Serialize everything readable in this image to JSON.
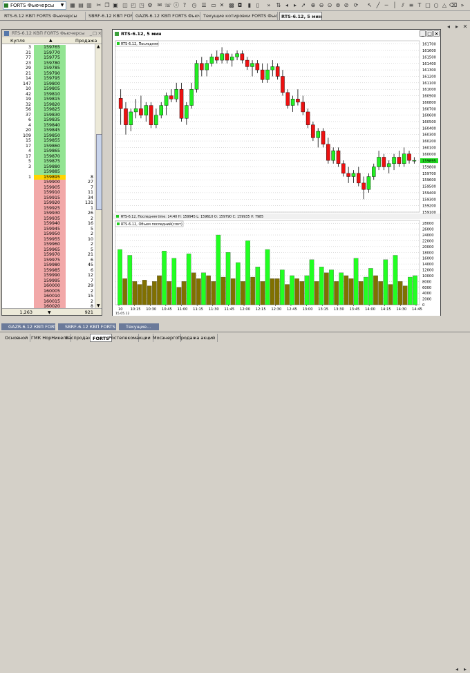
{
  "toolbar": {
    "instrument_select": "FORTS Фьючерсы"
  },
  "tabs": [
    {
      "label": "RTS-6.12 КВП FORTS Фьючерсы",
      "active": false
    },
    {
      "label": "SBRF-6.12 КВП FORTS Фьючерсы",
      "active": false
    },
    {
      "label": "GAZR-6.12 КВП FORTS Фьючерсы",
      "active": false
    },
    {
      "label": "Текущие котировки FORTS Фьючерсы",
      "active": false
    },
    {
      "label": "RTS-6.12, 5 мин",
      "active": true
    }
  ],
  "depth": {
    "title": "RTS-6.12 КВП FORTS Фьючерсы",
    "col_buy": "Купля",
    "col_sell": "Продажа",
    "footer_buy": "1,263",
    "footer_sell": "921",
    "rows": [
      {
        "buy": "3",
        "price": "159765",
        "sell": ""
      },
      {
        "buy": "31",
        "price": "159770",
        "sell": ""
      },
      {
        "buy": "77",
        "price": "159775",
        "sell": ""
      },
      {
        "buy": "23",
        "price": "159780",
        "sell": ""
      },
      {
        "buy": "29",
        "price": "159785",
        "sell": ""
      },
      {
        "buy": "21",
        "price": "159790",
        "sell": ""
      },
      {
        "buy": "14",
        "price": "159795",
        "sell": ""
      },
      {
        "buy": "147",
        "price": "159800",
        "sell": ""
      },
      {
        "buy": "10",
        "price": "159805",
        "sell": ""
      },
      {
        "buy": "42",
        "price": "159810",
        "sell": ""
      },
      {
        "buy": "19",
        "price": "159815",
        "sell": ""
      },
      {
        "buy": "32",
        "price": "159820",
        "sell": ""
      },
      {
        "buy": "56",
        "price": "159825",
        "sell": ""
      },
      {
        "buy": "37",
        "price": "159830",
        "sell": ""
      },
      {
        "buy": "6",
        "price": "159835",
        "sell": ""
      },
      {
        "buy": "4",
        "price": "159840",
        "sell": ""
      },
      {
        "buy": "20",
        "price": "159845",
        "sell": ""
      },
      {
        "buy": "109",
        "price": "159850",
        "sell": ""
      },
      {
        "buy": "15",
        "price": "159855",
        "sell": ""
      },
      {
        "buy": "17",
        "price": "159860",
        "sell": ""
      },
      {
        "buy": "4",
        "price": "159865",
        "sell": ""
      },
      {
        "buy": "17",
        "price": "159870",
        "sell": ""
      },
      {
        "buy": "5",
        "price": "159875",
        "sell": ""
      },
      {
        "buy": "3",
        "price": "159880",
        "sell": ""
      },
      {
        "buy": "",
        "price": "159885",
        "sell": ""
      },
      {
        "buy": "1",
        "price": "159895",
        "sell": "8",
        "current": true
      },
      {
        "buy": "",
        "price": "159900",
        "sell": "27"
      },
      {
        "buy": "",
        "price": "159905",
        "sell": "7"
      },
      {
        "buy": "",
        "price": "159910",
        "sell": "11"
      },
      {
        "buy": "",
        "price": "159915",
        "sell": "34"
      },
      {
        "buy": "",
        "price": "159920",
        "sell": "131"
      },
      {
        "buy": "",
        "price": "159925",
        "sell": "1"
      },
      {
        "buy": "",
        "price": "159930",
        "sell": "26"
      },
      {
        "buy": "",
        "price": "159935",
        "sell": "2"
      },
      {
        "buy": "",
        "price": "159940",
        "sell": "16"
      },
      {
        "buy": "",
        "price": "159945",
        "sell": "5"
      },
      {
        "buy": "",
        "price": "159950",
        "sell": "2"
      },
      {
        "buy": "",
        "price": "159955",
        "sell": "10"
      },
      {
        "buy": "",
        "price": "159960",
        "sell": "2"
      },
      {
        "buy": "",
        "price": "159965",
        "sell": "5"
      },
      {
        "buy": "",
        "price": "159970",
        "sell": "21"
      },
      {
        "buy": "",
        "price": "159975",
        "sell": "6"
      },
      {
        "buy": "",
        "price": "159980",
        "sell": "45"
      },
      {
        "buy": "",
        "price": "159985",
        "sell": "6"
      },
      {
        "buy": "",
        "price": "159990",
        "sell": "12"
      },
      {
        "buy": "",
        "price": "159995",
        "sell": "7"
      },
      {
        "buy": "",
        "price": "160000",
        "sell": "29"
      },
      {
        "buy": "",
        "price": "160005",
        "sell": "2"
      },
      {
        "buy": "",
        "price": "160010",
        "sell": "15"
      },
      {
        "buy": "",
        "price": "160015",
        "sell": "2"
      },
      {
        "buy": "",
        "price": "160020",
        "sell": "8"
      }
    ]
  },
  "chart": {
    "window_title": "RTS-6.12, 5 мин",
    "price_legend": "RTS-6.12, Последняя",
    "volume_info": "RTS-6.12, Последняя time: 14:40 H: 159945 L: 159610 O: 159790 C: 159935 V: 7985",
    "volume_legend": "RTS-6.12, Объем последний(слот)",
    "current_price_label": "159895",
    "colors": {
      "up": "#22ee22",
      "down": "#ee1111",
      "vol_up": "#22ff22",
      "vol_down": "#807000"
    }
  },
  "chart_data": [
    {
      "type": "candlestick",
      "y_ticks": [
        "161700",
        "161600",
        "161500",
        "161400",
        "161300",
        "161200",
        "161100",
        "161000",
        "160900",
        "160800",
        "160700",
        "160600",
        "160500",
        "160400",
        "160300",
        "160200",
        "160100",
        "160000",
        "159900",
        "159800",
        "159700",
        "159600",
        "159500",
        "159400",
        "159300",
        "159200",
        "159100"
      ],
      "ylim": [
        159100,
        161750
      ],
      "candles": [
        {
          "o": 160860,
          "h": 161000,
          "l": 160450,
          "c": 160700
        },
        {
          "o": 160700,
          "h": 160800,
          "l": 160300,
          "c": 160450
        },
        {
          "o": 160450,
          "h": 160700,
          "l": 160350,
          "c": 160650
        },
        {
          "o": 160650,
          "h": 160850,
          "l": 160550,
          "c": 160700
        },
        {
          "o": 160700,
          "h": 160900,
          "l": 160550,
          "c": 160600
        },
        {
          "o": 160600,
          "h": 160800,
          "l": 160500,
          "c": 160750
        },
        {
          "o": 160750,
          "h": 160800,
          "l": 160400,
          "c": 160450
        },
        {
          "o": 160450,
          "h": 160700,
          "l": 160400,
          "c": 160600
        },
        {
          "o": 160600,
          "h": 160800,
          "l": 160550,
          "c": 160750
        },
        {
          "o": 160750,
          "h": 160950,
          "l": 160600,
          "c": 160900
        },
        {
          "o": 160900,
          "h": 161000,
          "l": 160800,
          "c": 160850
        },
        {
          "o": 160850,
          "h": 161100,
          "l": 160800,
          "c": 161000
        },
        {
          "o": 161000,
          "h": 161100,
          "l": 160500,
          "c": 160550
        },
        {
          "o": 160550,
          "h": 160800,
          "l": 160450,
          "c": 160750
        },
        {
          "o": 160750,
          "h": 161100,
          "l": 160700,
          "c": 161000
        },
        {
          "o": 161000,
          "h": 161450,
          "l": 160950,
          "c": 161400
        },
        {
          "o": 161400,
          "h": 161500,
          "l": 161200,
          "c": 161300
        },
        {
          "o": 161300,
          "h": 161450,
          "l": 161200,
          "c": 161400
        },
        {
          "o": 161400,
          "h": 161550,
          "l": 161350,
          "c": 161500
        },
        {
          "o": 161500,
          "h": 161600,
          "l": 161400,
          "c": 161450
        },
        {
          "o": 161450,
          "h": 161650,
          "l": 161400,
          "c": 161550
        },
        {
          "o": 161550,
          "h": 161600,
          "l": 161400,
          "c": 161450
        },
        {
          "o": 161450,
          "h": 161550,
          "l": 161350,
          "c": 161500
        },
        {
          "o": 161500,
          "h": 161600,
          "l": 161450,
          "c": 161550
        },
        {
          "o": 161550,
          "h": 161600,
          "l": 161400,
          "c": 161450
        },
        {
          "o": 161450,
          "h": 161500,
          "l": 161300,
          "c": 161350
        },
        {
          "o": 161350,
          "h": 161450,
          "l": 161200,
          "c": 161400
        },
        {
          "o": 161400,
          "h": 161450,
          "l": 161250,
          "c": 161300
        },
        {
          "o": 161300,
          "h": 161400,
          "l": 161100,
          "c": 161150
        },
        {
          "o": 161150,
          "h": 161400,
          "l": 161100,
          "c": 161300
        },
        {
          "o": 161300,
          "h": 161450,
          "l": 161200,
          "c": 161350
        },
        {
          "o": 161350,
          "h": 161400,
          "l": 161150,
          "c": 161200
        },
        {
          "o": 161200,
          "h": 161300,
          "l": 160900,
          "c": 160950
        },
        {
          "o": 160950,
          "h": 161000,
          "l": 160700,
          "c": 160750
        },
        {
          "o": 160750,
          "h": 160900,
          "l": 160650,
          "c": 160850
        },
        {
          "o": 160850,
          "h": 161000,
          "l": 160750,
          "c": 160800
        },
        {
          "o": 160800,
          "h": 160900,
          "l": 160600,
          "c": 160650
        },
        {
          "o": 160650,
          "h": 160700,
          "l": 160400,
          "c": 160450
        },
        {
          "o": 160450,
          "h": 160500,
          "l": 160200,
          "c": 160250
        },
        {
          "o": 160250,
          "h": 160400,
          "l": 160100,
          "c": 160350
        },
        {
          "o": 160350,
          "h": 160400,
          "l": 160100,
          "c": 160150
        },
        {
          "o": 160150,
          "h": 160250,
          "l": 159850,
          "c": 159900
        },
        {
          "o": 159900,
          "h": 160100,
          "l": 159850,
          "c": 160050
        },
        {
          "o": 160050,
          "h": 160100,
          "l": 159800,
          "c": 159850
        },
        {
          "o": 159850,
          "h": 159900,
          "l": 159650,
          "c": 159700
        },
        {
          "o": 159700,
          "h": 159800,
          "l": 159550,
          "c": 159650
        },
        {
          "o": 159650,
          "h": 159750,
          "l": 159550,
          "c": 159700
        },
        {
          "o": 159700,
          "h": 159800,
          "l": 159500,
          "c": 159550
        },
        {
          "o": 159550,
          "h": 159650,
          "l": 159300,
          "c": 159450
        },
        {
          "o": 159450,
          "h": 159700,
          "l": 159400,
          "c": 159650
        },
        {
          "o": 159650,
          "h": 159850,
          "l": 159600,
          "c": 159800
        },
        {
          "o": 159800,
          "h": 160050,
          "l": 159750,
          "c": 159950
        },
        {
          "o": 159950,
          "h": 160000,
          "l": 159750,
          "c": 159800
        },
        {
          "o": 159800,
          "h": 159900,
          "l": 159700,
          "c": 159850
        },
        {
          "o": 159850,
          "h": 160000,
          "l": 159750,
          "c": 159950
        },
        {
          "o": 159950,
          "h": 160050,
          "l": 159800,
          "c": 159850
        },
        {
          "o": 159850,
          "h": 160100,
          "l": 159800,
          "c": 160000
        },
        {
          "o": 160000,
          "h": 160050,
          "l": 159850,
          "c": 159900
        },
        {
          "o": 159900,
          "h": 159950,
          "l": 159850,
          "c": 159900
        }
      ]
    },
    {
      "type": "bar",
      "y_ticks": [
        "28000",
        "26000",
        "24000",
        "22000",
        "20000",
        "18000",
        "16000",
        "14000",
        "12000",
        "10000",
        "8000",
        "6000",
        "4000",
        "2000",
        "0"
      ],
      "ylim": [
        0,
        29000
      ],
      "x_ticks": [
        "10",
        "10:15",
        "10:30",
        "10:45",
        "11:00",
        "11:15",
        "11:30",
        "11:45",
        "12:00",
        "12:15",
        "12:30",
        "12:45",
        "13:00",
        "13:15",
        "13:30",
        "13:45",
        "14:00",
        "14:15",
        "14:30",
        "14:45"
      ],
      "date_label": "15.05.12",
      "values": [
        19000,
        9000,
        17000,
        8000,
        7000,
        8500,
        6500,
        8000,
        10000,
        18500,
        8000,
        16000,
        6000,
        8000,
        17500,
        11000,
        9000,
        11000,
        10000,
        8000,
        24000,
        9500,
        18000,
        9000,
        14500,
        8000,
        22000,
        9500,
        13000,
        8000,
        19000,
        9000,
        9000,
        12000,
        7000,
        10000,
        9000,
        8000,
        10000,
        15500,
        8000,
        13000,
        11000,
        12000,
        8000,
        11000,
        10000,
        9000,
        16000,
        8000,
        9500,
        12500,
        10000,
        8000,
        15500,
        7000,
        17000,
        8000,
        6500,
        9500,
        10000
      ],
      "up": [
        true,
        false,
        true,
        false,
        false,
        false,
        false,
        false,
        false,
        true,
        false,
        true,
        false,
        false,
        true,
        false,
        false,
        true,
        false,
        false,
        true,
        false,
        true,
        false,
        true,
        false,
        true,
        false,
        true,
        false,
        true,
        false,
        false,
        true,
        false,
        true,
        false,
        false,
        true,
        true,
        false,
        true,
        false,
        true,
        false,
        true,
        false,
        false,
        true,
        false,
        true,
        true,
        false,
        false,
        true,
        false,
        true,
        false,
        false,
        true,
        true
      ]
    }
  ],
  "mdi_windows": [
    {
      "label": "GAZR-6.12 КВП FORTS Фью..."
    },
    {
      "label": "SBRF-6.12 КВП FORTS Фью..."
    },
    {
      "label": "Текущие..."
    }
  ],
  "bottom_tabs": [
    {
      "label": "Основной",
      "active": false
    },
    {
      "label": "ГМК НорНикель",
      "active": false
    },
    {
      "label": "Распродажа",
      "active": false
    },
    {
      "label": "FORTS",
      "active": true
    },
    {
      "label": "Ростелеком",
      "active": false
    },
    {
      "label": "акции",
      "active": false
    },
    {
      "label": "Мосэнерго",
      "active": false
    },
    {
      "label": "Продажа акций",
      "active": false
    }
  ]
}
